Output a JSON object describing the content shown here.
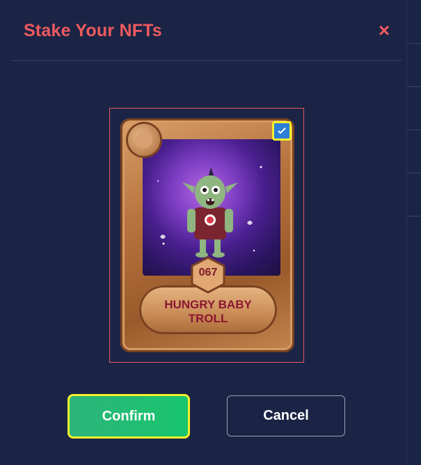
{
  "modal": {
    "title": "Stake Your NFTs",
    "close_symbol": "×"
  },
  "nft_card": {
    "number": "067",
    "name_line1": "HUNGRY BABY",
    "name_line2": "TROLL",
    "selected": true
  },
  "actions": {
    "confirm_label": "Confirm",
    "cancel_label": "Cancel"
  },
  "colors": {
    "accent_red": "#ee5a5e",
    "confirm_green": "#18c56e",
    "highlight_yellow": "#f4f02a",
    "checkbox_blue": "#2d7fd6"
  },
  "icons": {
    "close": "close-icon",
    "check": "checkmark-icon"
  }
}
